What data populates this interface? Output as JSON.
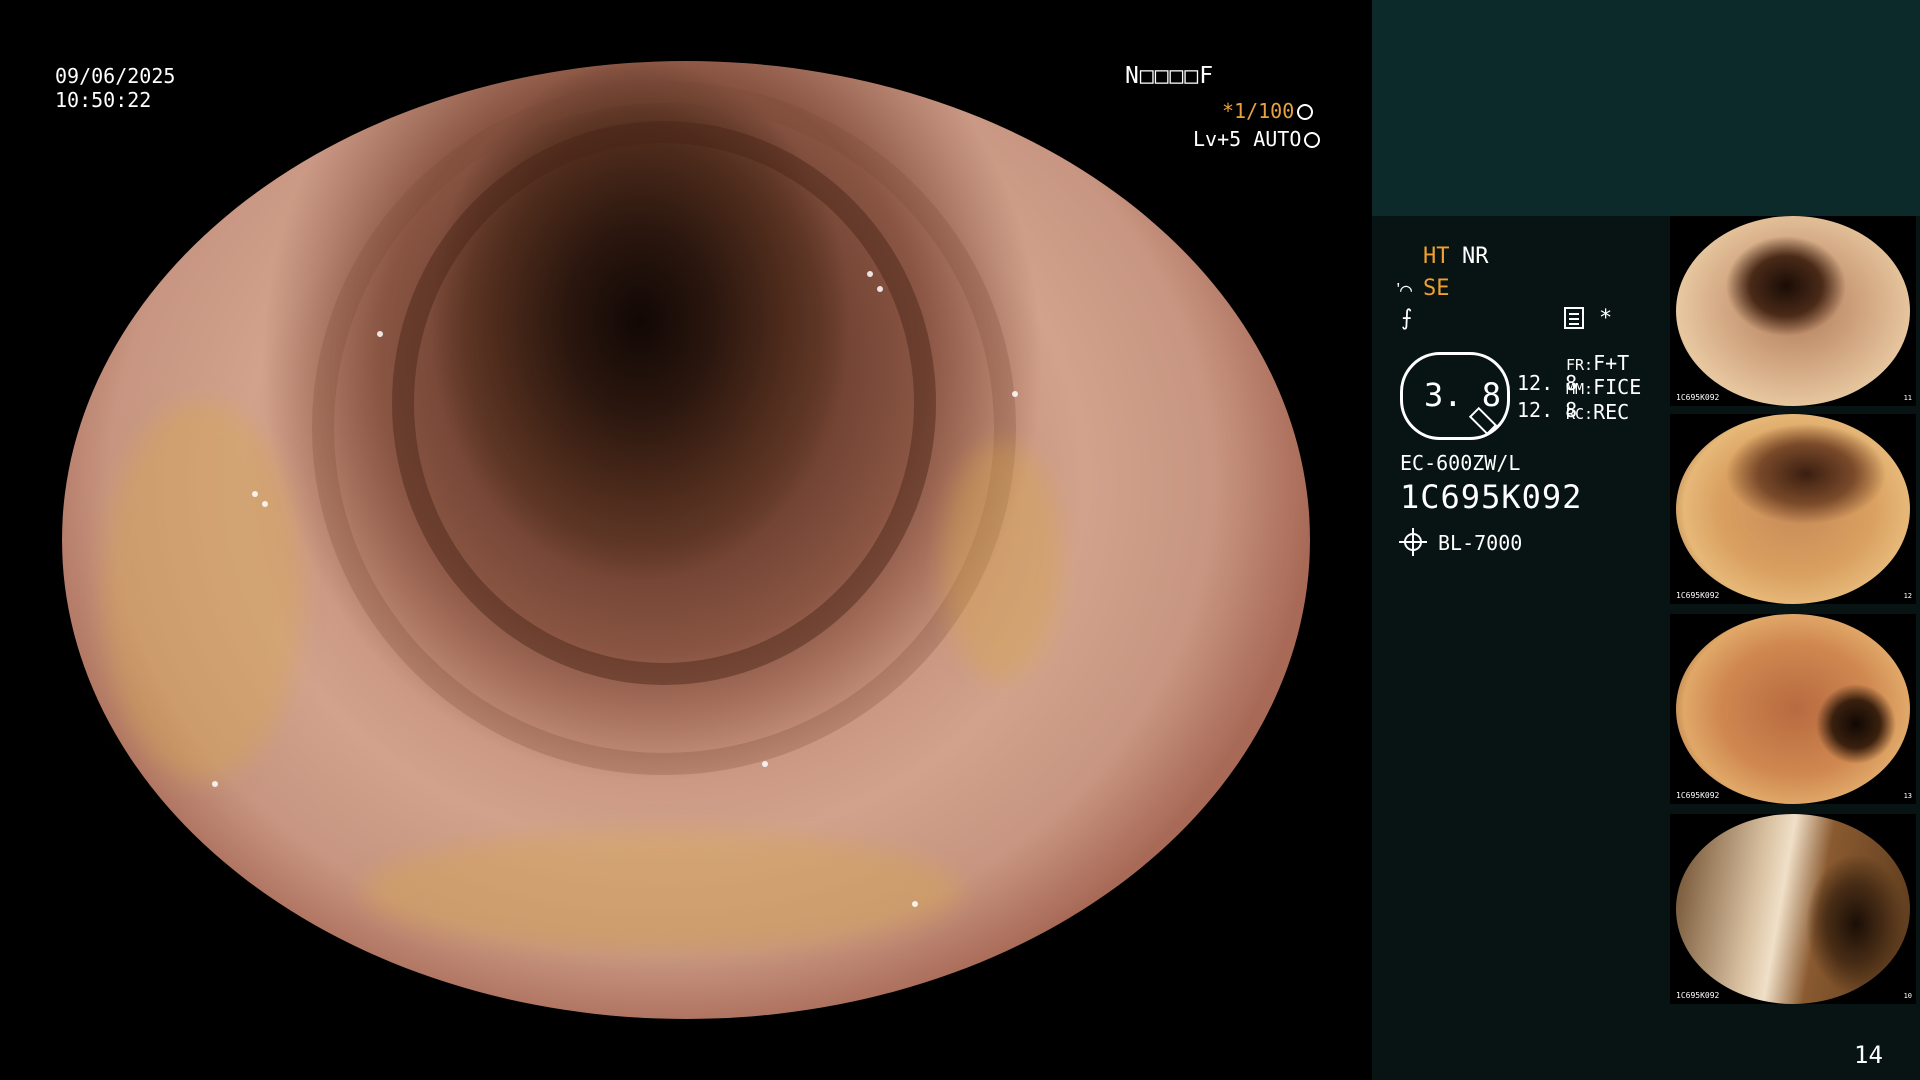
{
  "overlay": {
    "date": "09/06/2025",
    "time": "10:50:22",
    "patient_id": "N□□□□F",
    "shutter": "*1/100",
    "level": "Lv+5 AUTO"
  },
  "panel": {
    "ht": "HT",
    "nr": "NR",
    "se": "SE",
    "f_symbol": "⨍",
    "se_symbol": "ᡃ⌒",
    "asterisk": "*",
    "octagon_value": "3. 8",
    "value_1": "12. 8",
    "value_2": "12. 8",
    "fr_label": "FR:",
    "fr_value": "F+T",
    "mm_label": "MM:",
    "mm_value": "FICE",
    "rc_label": "RC:",
    "rc_value": "REC",
    "scope_model": "EC-600ZW/L",
    "scope_serial": "1C695K092",
    "light_source": "BL-7000",
    "page_number": "14"
  },
  "thumbnails": [
    {
      "id_text": "1C695K092",
      "number": "11"
    },
    {
      "id_text": "1C695K092",
      "number": "12"
    },
    {
      "id_text": "1C695K092",
      "number": "13"
    },
    {
      "id_text": "1C695K092",
      "number": "10"
    }
  ],
  "colors": {
    "accent_orange": "#f0a030",
    "panel_bg": "#071413",
    "panel_top_bg": "#0c2a2a"
  }
}
